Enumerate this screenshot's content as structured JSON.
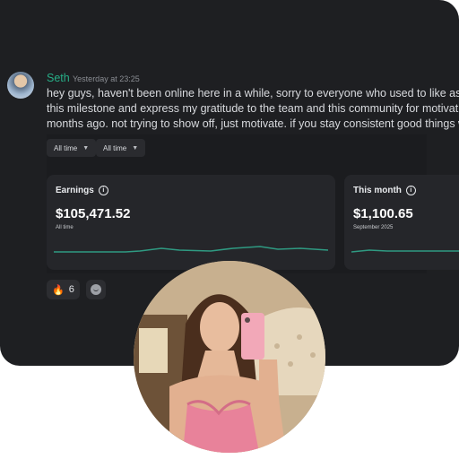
{
  "message": {
    "author": "Seth",
    "timestamp": "Yesterday at 23:25",
    "lines": [
      "hey guys, haven't been online here in a while, sorry to everyone who used to like asking m",
      "this milestone and express my gratitude to the team and this community for motivating r",
      "months ago. not trying to show off, just motivate. if you stay consistent good things will c"
    ]
  },
  "filters": [
    {
      "label": "All time"
    },
    {
      "label": "All time"
    }
  ],
  "cards": [
    {
      "title": "Earnings",
      "value": "$105,471.52",
      "subtitle": "All time"
    },
    {
      "title": "This month",
      "value": "$1,100.65",
      "subtitle": "September 2025"
    }
  ],
  "reactions": [
    {
      "emoji": "🔥",
      "count": "6"
    }
  ],
  "colors": {
    "background": "#1e1f22",
    "card": "#25262a",
    "author": "#27ae87",
    "sparkline": "#2f9a82"
  },
  "icons": [
    "info-icon",
    "chevron-down-icon",
    "fire-emoji",
    "add-reaction-icon"
  ]
}
